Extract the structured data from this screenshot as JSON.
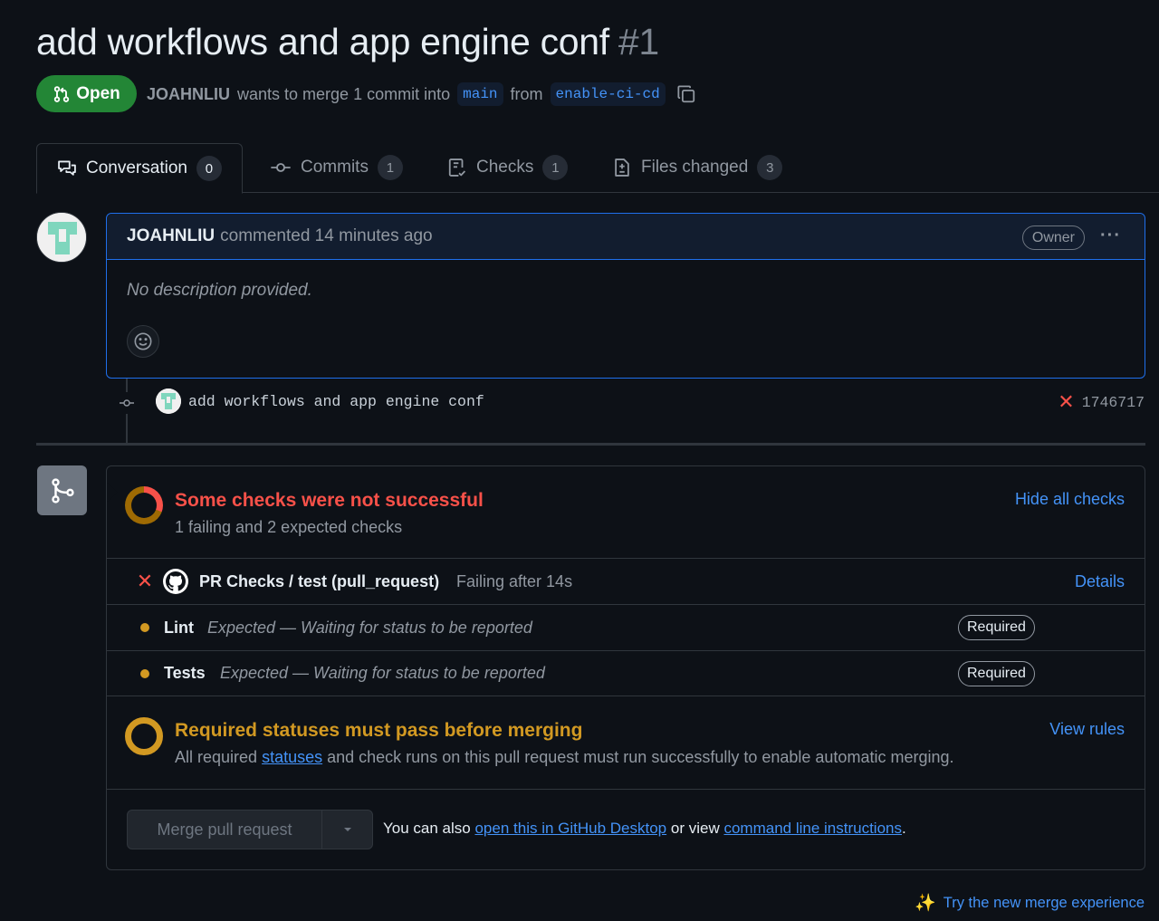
{
  "pr": {
    "title": "add workflows and app engine conf",
    "number": "#1",
    "state": "Open",
    "author": "JOAHNLIU",
    "merge_text": "wants to merge 1 commit into",
    "base_branch": "main",
    "from_text": "from",
    "head_branch": "enable-ci-cd"
  },
  "tabs": [
    {
      "label": "Conversation",
      "count": "0",
      "icon": "comment-discussion-icon"
    },
    {
      "label": "Commits",
      "count": "1",
      "icon": "git-commit-icon"
    },
    {
      "label": "Checks",
      "count": "1",
      "icon": "checklist-icon"
    },
    {
      "label": "Files changed",
      "count": "3",
      "icon": "file-diff-icon"
    }
  ],
  "comment": {
    "author": "JOAHNLIU",
    "time": "commented 14 minutes ago",
    "role_label": "Owner",
    "body": "No description provided.",
    "menu_glyph": "···"
  },
  "commit": {
    "message": "add workflows and app engine conf",
    "status_glyph": "✕",
    "sha": "1746717"
  },
  "checks_summary": {
    "title": "Some checks were not successful",
    "subtitle": "1 failing and 2 expected checks",
    "toggle_label": "Hide all checks",
    "title_color": "#f85149"
  },
  "checks": [
    {
      "status": "failure",
      "glyph": "✕",
      "name": "PR Checks / test (pull_request)",
      "description": "Failing after 14s",
      "action": "Details"
    },
    {
      "status": "expected",
      "name": "Lint",
      "description": "Expected — Waiting for status to be reported",
      "label": "Required"
    },
    {
      "status": "expected",
      "name": "Tests",
      "description": "Expected — Waiting for status to be reported",
      "label": "Required"
    }
  ],
  "required": {
    "title": "Required statuses must pass before merging",
    "text_before": "All required",
    "link": "statuses",
    "text_after": "and check runs on this pull request must run successfully to enable automatic merging.",
    "rules_link": "View rules",
    "title_color": "#d29922"
  },
  "merge": {
    "button_label": "Merge pull request",
    "also_text": "You can also",
    "desktop_link": "open this in GitHub Desktop",
    "or_view_text": "or view",
    "cli_link": "command line instructions",
    "end": "."
  },
  "footer": {
    "sparkle": "✨",
    "new_experience_link": "Try the new merge experience"
  },
  "colors": {
    "background": "#0d1117",
    "open_green": "#238636",
    "link_blue": "#4493f8",
    "fail_red": "#f85149",
    "pending_yellow": "#d29922"
  }
}
